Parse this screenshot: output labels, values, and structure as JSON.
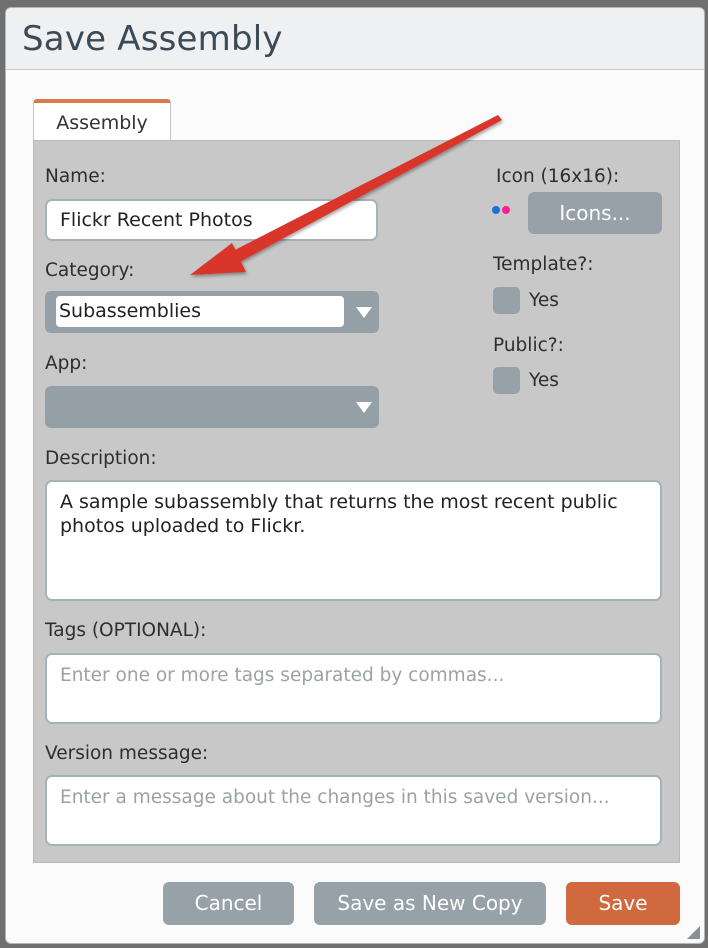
{
  "dialog": {
    "title": "Save Assembly",
    "tab_label": "Assembly"
  },
  "form": {
    "name_label": "Name:",
    "name_value": "Flickr Recent Photos",
    "category_label": "Category:",
    "category_value": "Subassemblies",
    "app_label": "App:",
    "app_value": "",
    "description_label": "Description:",
    "description_value": "A sample subassembly that returns the most recent public photos uploaded to Flickr.",
    "tags_label": "Tags (OPTIONAL):",
    "tags_placeholder": "Enter one or more tags separated by commas...",
    "version_label": "Version message:",
    "version_placeholder": "Enter a message about the changes in this saved version..."
  },
  "side": {
    "icon_label": "Icon (16x16):",
    "icons_button": "Icons...",
    "template_label": "Template?:",
    "template_option": "Yes",
    "template_checked": false,
    "public_label": "Public?:",
    "public_option": "Yes",
    "public_checked": false
  },
  "footer": {
    "cancel_label": "Cancel",
    "save_copy_label": "Save as New Copy",
    "save_label": "Save"
  },
  "colors": {
    "accent": "#d0693d",
    "button_grey": "#96a2a8",
    "panel": "#c8c8c8",
    "annotation_arrow": "#d9352a",
    "flickr_blue": "#1d6fdc",
    "flickr_pink": "#ff1f8e"
  },
  "icons": [
    "flickr-icon",
    "dropdown-caret-icon",
    "resize-grip-icon",
    "annotation-arrow"
  ]
}
